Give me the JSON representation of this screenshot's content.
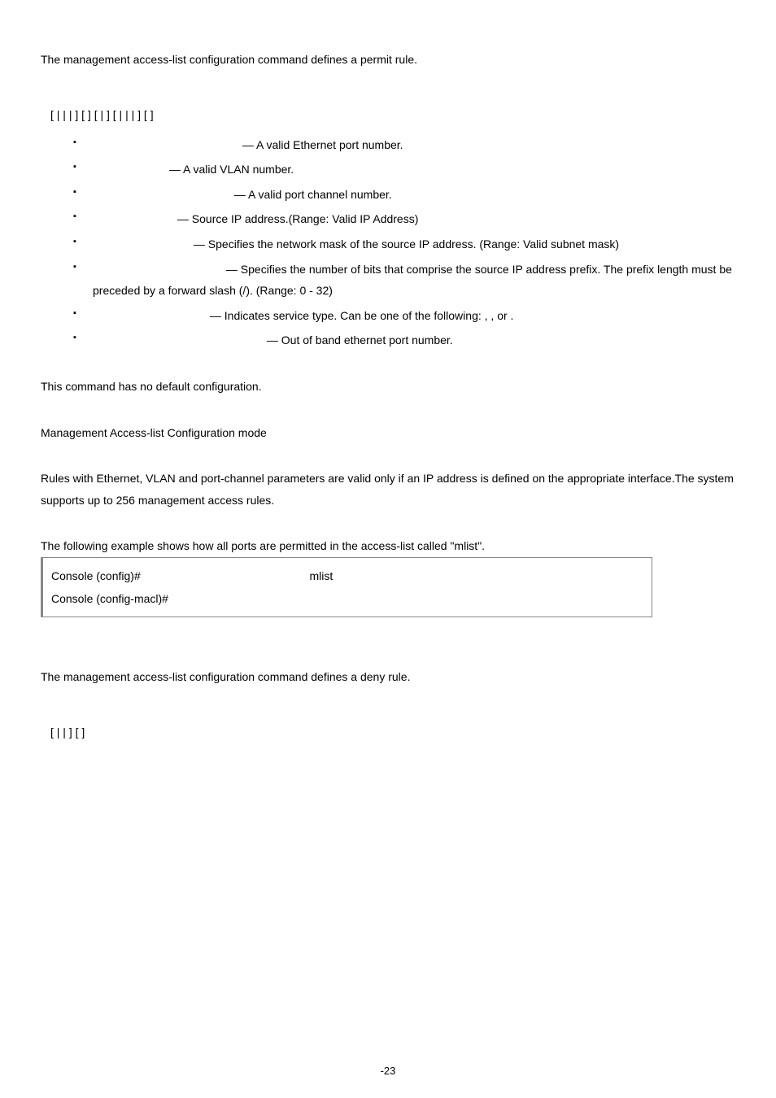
{
  "permit": {
    "intro_pre": "The ",
    "intro_post": " management access-list configuration command defines a permit rule.",
    "syntax": "[                                |                 |                               |                                                ] [                ]                                [                |                 ] [                              |                 |                 |                                ] [                ]"
  },
  "bullets": {
    "b1": " — A valid Ethernet port number.",
    "b2": " — A valid VLAN number.",
    "b3": " — A valid port channel number.",
    "b4": " — Source IP address.(Range: Valid IP Address)",
    "b5": " — Specifies the network mask of the source IP address. (Range: Valid subnet mask)",
    "b6": " — Specifies the number of bits that comprise the source IP address prefix. The prefix length must be preceded by a forward slash (/). (Range: 0 - 32)",
    "b7a": " — Indicates service type. Can be one of the following:        ",
    "b7b": ",       ",
    "b7c": ",                 ",
    "b7d": " or        ",
    "b7e": ".",
    "b8": " — Out of band ethernet port number."
  },
  "default_cfg": "This command has no default configuration.",
  "command_mode": "Management Access-list Configuration mode",
  "user_guidelines": "Rules with Ethernet, VLAN and port-channel parameters are valid only if an IP address is defined on the appropriate interface.The system supports up to 256 management access rules.",
  "example_intro": "The following example shows how all ports are permitted in the access-list called \"mlist\".",
  "example": {
    "line1a": "Console (config)# ",
    "line1b": " mlist",
    "line2": "Console (config-macl)# "
  },
  "deny": {
    "intro_pre": "The ",
    "intro_post": " management access-list configuration command defines a deny rule.",
    "syntax": "[                                |                 |                               ] [                ]"
  },
  "pagenum": "-23"
}
